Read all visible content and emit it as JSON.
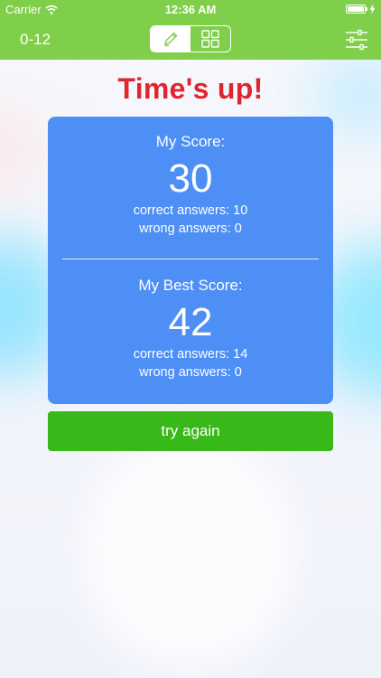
{
  "status_bar": {
    "carrier": "Carrier",
    "time": "12:36 AM",
    "battery_level": 1.0
  },
  "nav_bar": {
    "title": "0-12",
    "segments": [
      {
        "icon": "pencil-icon",
        "active": true
      },
      {
        "icon": "grid-icon",
        "active": false
      }
    ],
    "settings_icon": "sliders-icon"
  },
  "result": {
    "title": "Time's up!",
    "my_score": {
      "label": "My Score:",
      "value": "30",
      "correct": "correct answers: 10",
      "wrong": "wrong answers: 0"
    },
    "best_score": {
      "label": "My Best Score:",
      "value": "42",
      "correct": "correct answers: 14",
      "wrong": "wrong answers: 0"
    }
  },
  "actions": {
    "try_again": "try again"
  },
  "colors": {
    "bar": "#7fcf4a",
    "title": "#e0252f",
    "card": "#4d8ff5",
    "button": "#39b819"
  }
}
